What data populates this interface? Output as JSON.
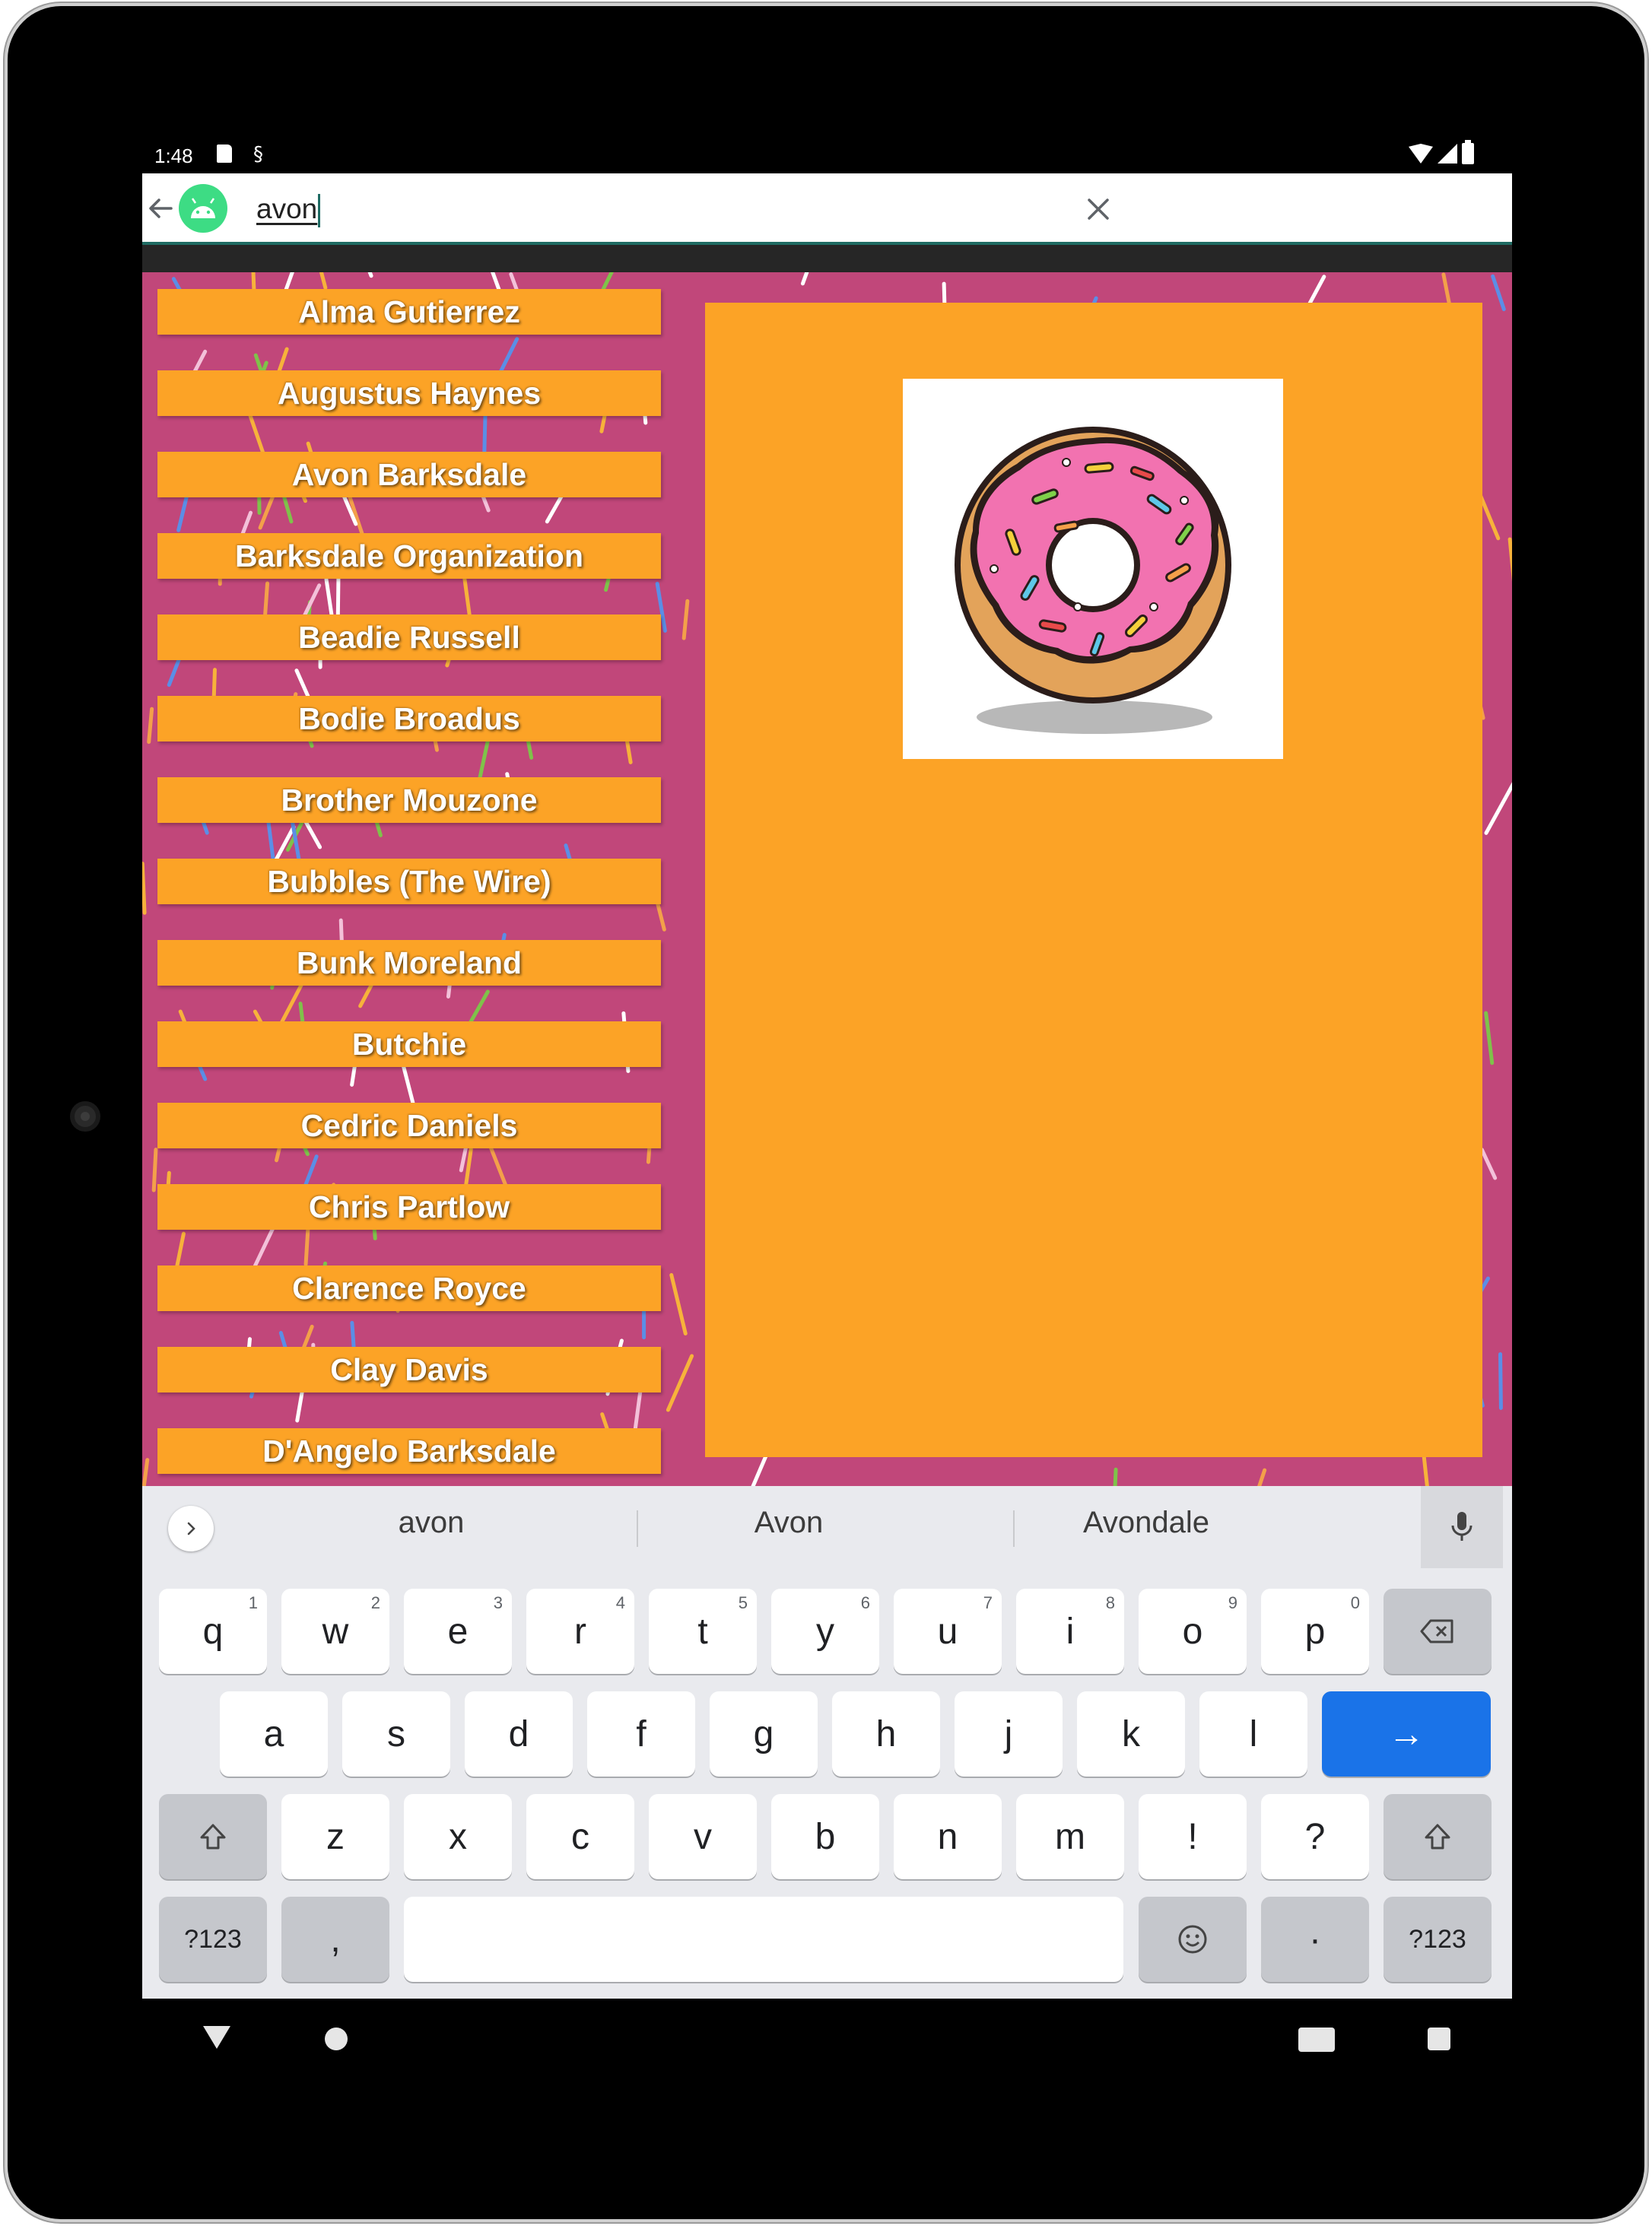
{
  "status_bar": {
    "time": "1:48"
  },
  "search": {
    "query": "avon",
    "icons": {
      "back": "arrow-left-icon",
      "app": "android-icon",
      "clear": "close-icon"
    }
  },
  "list": {
    "items": [
      "Alma Gutierrez",
      "Augustus Haynes",
      "Avon Barksdale",
      "Barksdale Organization",
      "Beadie Russell",
      "Bodie Broadus",
      "Brother Mouzone",
      "Bubbles (The Wire)",
      "Bunk Moreland",
      "Butchie",
      "Cedric Daniels",
      "Chris Partlow",
      "Clarence Royce",
      "Clay Davis",
      "D'Angelo Barksdale"
    ]
  },
  "detail": {
    "image": "donut-image"
  },
  "keyboard": {
    "suggestions": [
      "avon",
      "Avon",
      "Avondale"
    ],
    "row1": [
      {
        "label": "q",
        "hint": "1"
      },
      {
        "label": "w",
        "hint": "2"
      },
      {
        "label": "e",
        "hint": "3"
      },
      {
        "label": "r",
        "hint": "4"
      },
      {
        "label": "t",
        "hint": "5"
      },
      {
        "label": "y",
        "hint": "6"
      },
      {
        "label": "u",
        "hint": "7"
      },
      {
        "label": "i",
        "hint": "8"
      },
      {
        "label": "o",
        "hint": "9"
      },
      {
        "label": "p",
        "hint": "0"
      }
    ],
    "row2": [
      "a",
      "s",
      "d",
      "f",
      "g",
      "h",
      "j",
      "k",
      "l"
    ],
    "row3": [
      "z",
      "x",
      "c",
      "v",
      "b",
      "n",
      "m",
      "!",
      "?"
    ],
    "symbols_label": "?123",
    "comma_label": ",",
    "period_label": "·",
    "enter_label": "→"
  },
  "colors": {
    "accent": "#1f6b63",
    "background_pink": "#c1477a",
    "orange": "#fca326",
    "enter_blue": "#1a73e8"
  }
}
